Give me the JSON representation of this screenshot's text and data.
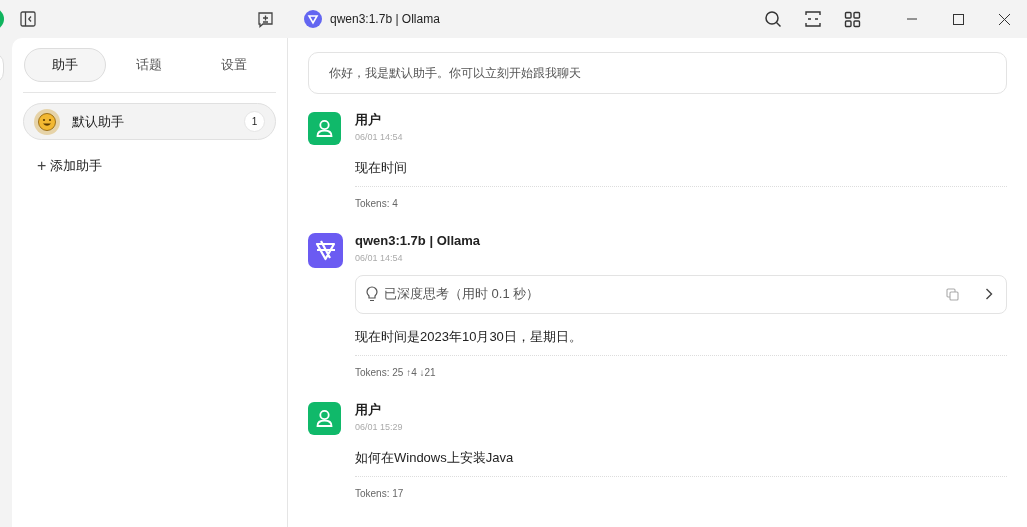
{
  "window": {
    "title": "qwen3:1.7b | Ollama"
  },
  "sidebar": {
    "tabs": [
      {
        "label": "助手",
        "selected": true
      },
      {
        "label": "话题",
        "selected": false
      },
      {
        "label": "设置",
        "selected": false
      }
    ],
    "assistants": [
      {
        "name": "默认助手",
        "count": "1",
        "selected": true
      }
    ],
    "add_label": "添加助手",
    "add_icon": "+"
  },
  "welcome": "你好，我是默认助手。你可以立刻开始跟我聊天",
  "messages": [
    {
      "kind": "user",
      "author": "用户",
      "time": "06/01 14:54",
      "text": "现在时间",
      "tokens": "Tokens: 4"
    },
    {
      "kind": "assistant",
      "author": "qwen3:1.7b | Ollama",
      "time": "06/01 14:54",
      "thinking": "已深度思考（用时 0.1 秒）",
      "text": "现在时间是2023年10月30日，星期日。",
      "tokens": "Tokens: 25 ↑4 ↓21"
    },
    {
      "kind": "user",
      "author": "用户",
      "time": "06/01 15:29",
      "text": "如何在Windows上安装Java",
      "tokens": "Tokens: 17"
    }
  ]
}
